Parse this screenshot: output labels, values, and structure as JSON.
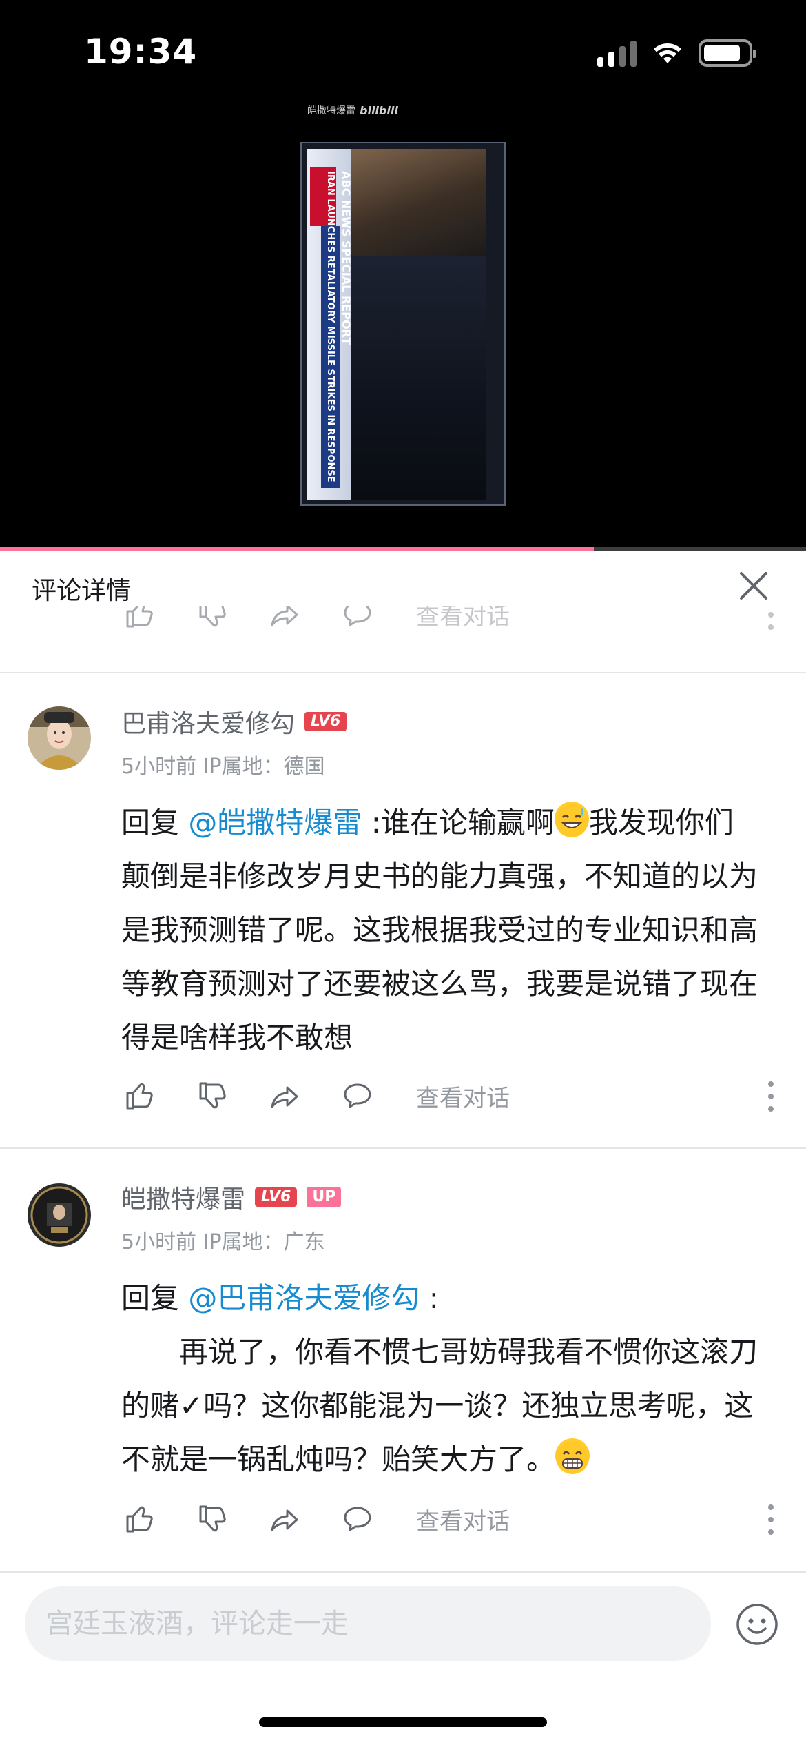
{
  "status_bar": {
    "time": "19:34"
  },
  "video": {
    "watermark_user": "皑撒特爆雷",
    "watermark_logo": "bilibili",
    "news_headline": "ABC NEWS SPECIAL REPORT",
    "news_ticker": "IRAN LAUNCHES RETALIATORY MISSILE STRIKES IN RESPONSE",
    "progress": 0.737
  },
  "sheet": {
    "title": "评论详情",
    "faded_view_thread": "查看对话"
  },
  "comments": [
    {
      "username": "巴甫洛夫爱修勾",
      "level": "LV6",
      "is_up": false,
      "time": "5小时前",
      "ip_label": "IP属地：德国",
      "reply_prefix": "回复",
      "mention": "@皑撒特爆雷",
      "text_part1": " :谁在论输赢啊",
      "emoji": "sweat-smile",
      "text_part2": "我发现你们颠倒是非修改岁月史书的能力真强，不知道的以为是我预测错了呢。这我根据我受过的专业知识和高等教育预测对了还要被这么骂，我要是说错了现在得是啥样我不敢想",
      "view_thread": "查看对话"
    },
    {
      "username": "皑撒特爆雷",
      "level": "LV6",
      "up_label": "UP",
      "is_up": true,
      "time": "5小时前",
      "ip_label": "IP属地：广东",
      "reply_prefix": "回复",
      "mention": "@巴甫洛夫爱修勾",
      "reply_suffix": " :",
      "text": "　　再说了，你看不惯七哥妨碍我看不惯你这滚刀的赌✓吗？这你都能混为一谈？还独立思考呢，这不就是一锅乱炖吗？贻笑大方了。",
      "emoji": "grin",
      "view_thread": "查看对话"
    }
  ],
  "input": {
    "placeholder": "宫廷玉液酒，评论走一走"
  },
  "colors": {
    "accent": "#fb7299",
    "mention": "#178bcf",
    "level_badge": "#e5454f",
    "meta": "#9499a0"
  }
}
